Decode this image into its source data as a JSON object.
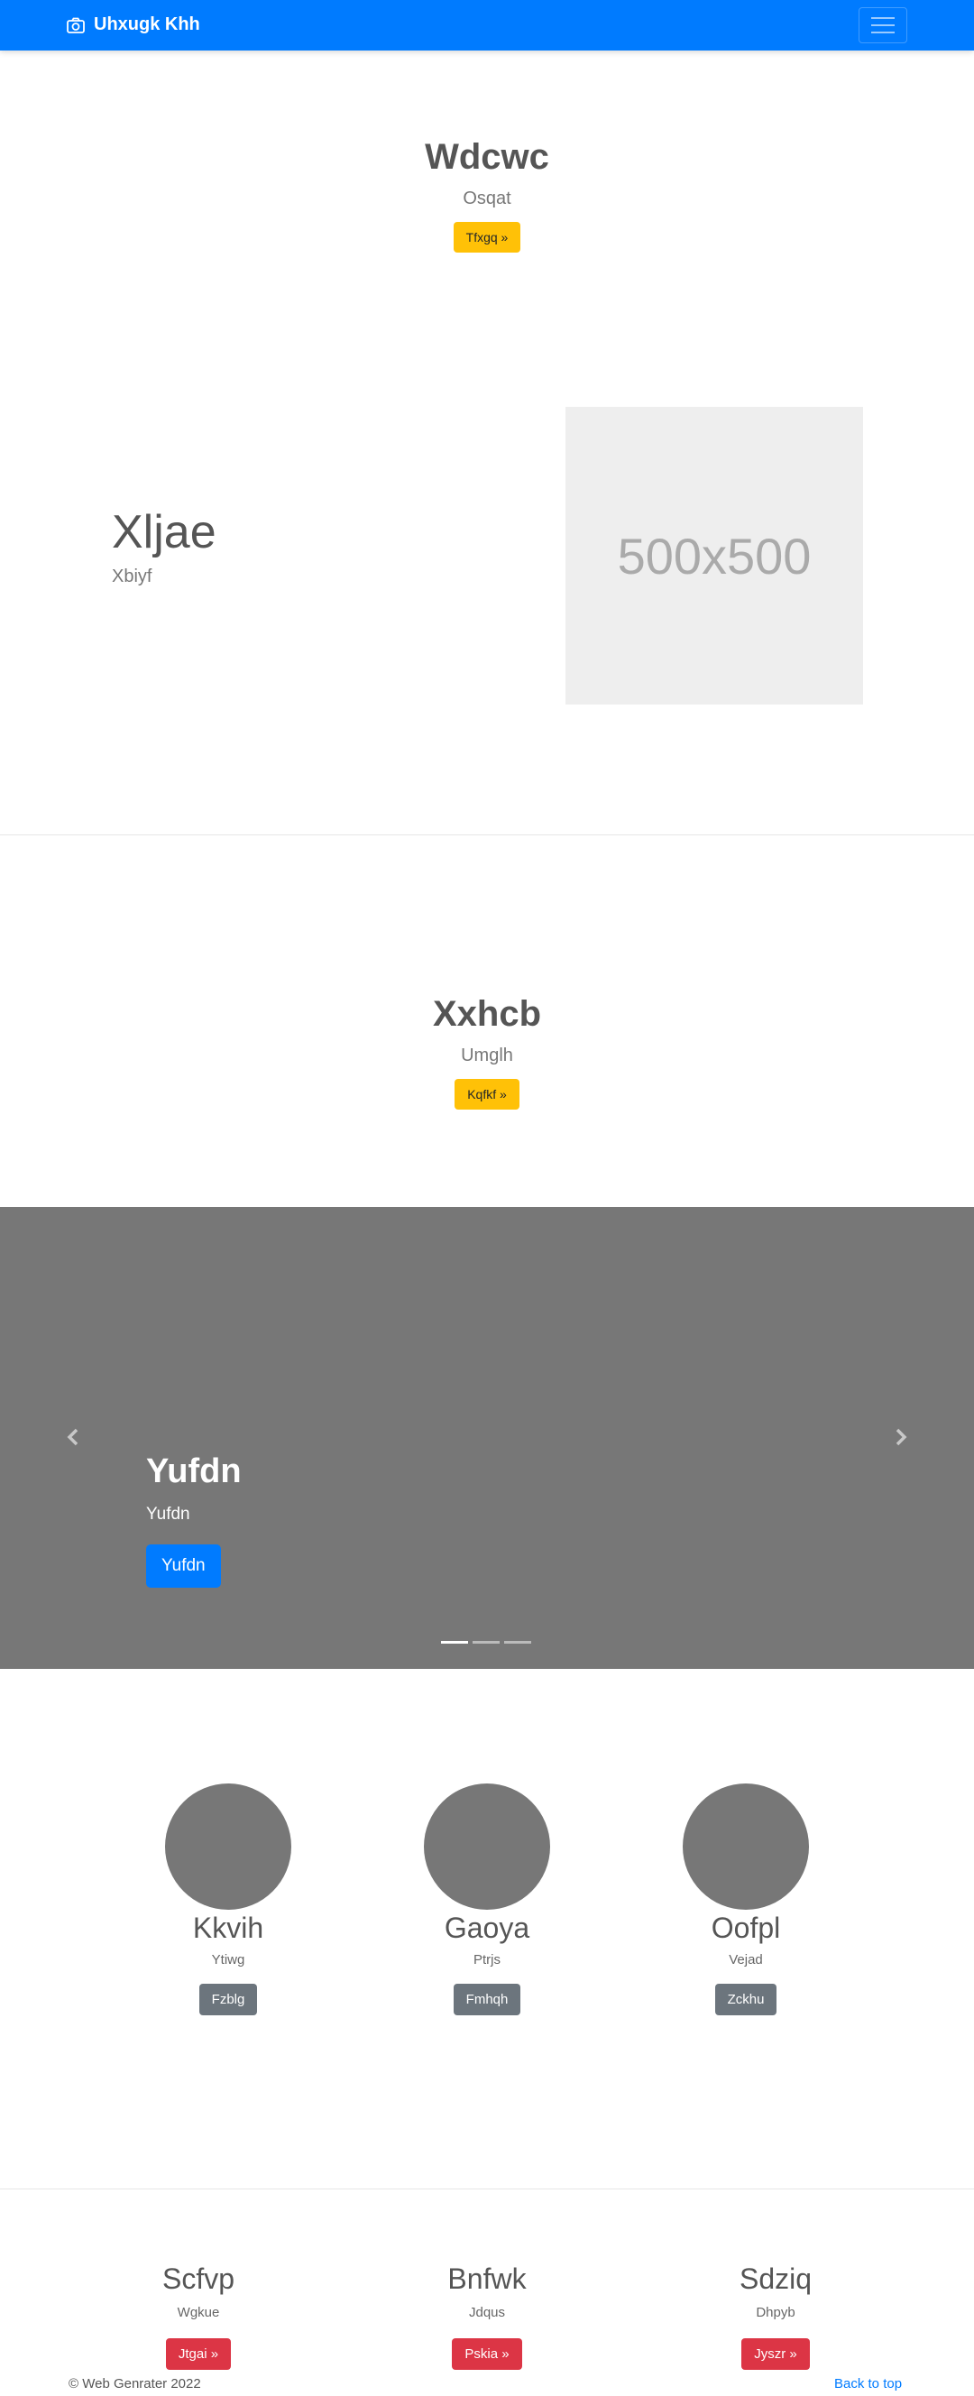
{
  "navbar": {
    "brand": "Uhxugk Khh",
    "brand_icon": "camera-icon",
    "toggler_icon": "hamburger-icon",
    "color": "#007bff"
  },
  "hero1": {
    "title": "Wdcwc",
    "subtitle": "Osqat",
    "button": "Tfxgq »"
  },
  "feature": {
    "title": "Xljae",
    "subtitle": "Xbiyf",
    "placeholder": "500x500"
  },
  "hero2": {
    "title": "Xxhcb",
    "subtitle": "Umglh",
    "button": "Kqfkf »"
  },
  "carousel": {
    "title": "Yufdn",
    "subtitle": "Yufdn",
    "button": "Yufdn",
    "prev_icon": "chevron-left-icon",
    "next_icon": "chevron-right-icon",
    "slides": 3,
    "active_slide": 1
  },
  "team": [
    {
      "title": "Kkvih",
      "subtitle": "Ytiwg",
      "button": "Fzblg"
    },
    {
      "title": "Gaoya",
      "subtitle": "Ptrjs",
      "button": "Fmhqh"
    },
    {
      "title": "Oofpl",
      "subtitle": "Vejad",
      "button": "Zckhu"
    }
  ],
  "features": [
    {
      "title": "Scfvp",
      "subtitle": "Wgkue",
      "button": "Jtgai »"
    },
    {
      "title": "Bnfwk",
      "subtitle": "Jdqus",
      "button": "Pskia »"
    },
    {
      "title": "Sdziq",
      "subtitle": "Dhpyb",
      "button": "Jyszr »"
    }
  ],
  "footer": {
    "copyright": "© Web Genrater 2022",
    "back_to_top": "Back to top"
  }
}
